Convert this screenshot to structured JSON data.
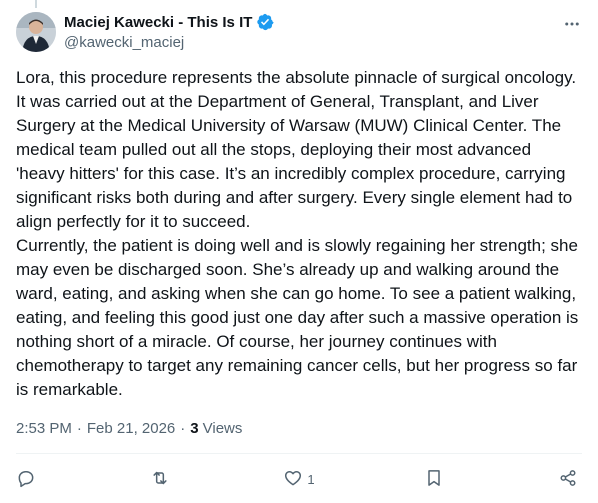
{
  "author": {
    "display_name": "Maciej Kawecki - This Is IT",
    "handle": "@kawecki_maciej",
    "verified": true
  },
  "post": {
    "paragraphs": [
      "Lora, this procedure represents the absolute pinnacle of surgical oncology. It was carried out at the Department of General, Transplant, and Liver Surgery at the Medical University of Warsaw (MUW) Clinical Center. The medical team pulled out all the stops, deploying their most advanced 'heavy hitters' for this case. It’s an incredibly complex procedure, carrying significant risks both during and after surgery. Every single element had to align perfectly for it to succeed.",
      "Currently, the patient is doing well and is slowly regaining her strength; she may even be discharged soon. She’s already up and walking around the ward, eating, and asking when she can go home. To see a patient walking, eating, and feeling this good just one day after such a massive operation is nothing short of a miracle. Of course, her journey continues with chemotherapy to target any remaining cancer cells, but her progress so far is remarkable."
    ],
    "time": "2:53 PM",
    "date": "Feb 21, 2026",
    "separator": "·",
    "views_count": "3",
    "views_label": "Views"
  },
  "actions": {
    "reply": {
      "icon": "reply-icon",
      "count": ""
    },
    "repost": {
      "icon": "repost-icon",
      "count": ""
    },
    "like": {
      "icon": "heart-icon",
      "count": "1"
    },
    "bookmark": {
      "icon": "bookmark-icon",
      "count": ""
    },
    "share": {
      "icon": "share-icon",
      "count": ""
    }
  },
  "colors": {
    "text": "#0f1419",
    "secondary": "#536471",
    "verified": "#1d9bf0",
    "divider": "#eff3f4"
  }
}
